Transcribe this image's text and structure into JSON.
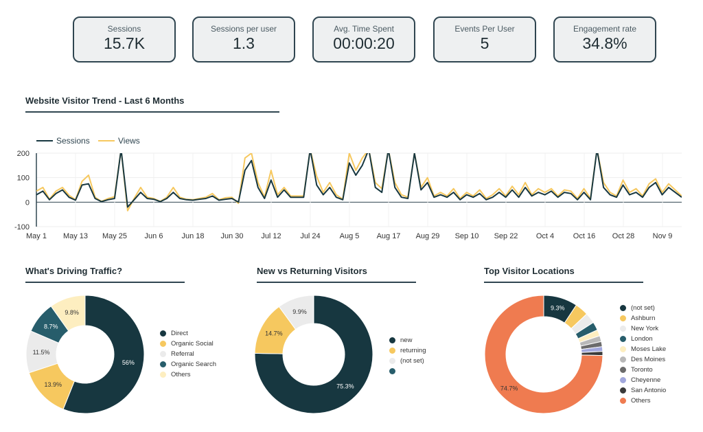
{
  "kpis": [
    {
      "label": "Sessions",
      "value": "15.7K"
    },
    {
      "label": "Sessions per user",
      "value": "1.3"
    },
    {
      "label": "Avg. Time Spent",
      "value": "00:00:20"
    },
    {
      "label": "Events Per User",
      "value": "5"
    },
    {
      "label": "Engagement rate",
      "value": "34.8%"
    }
  ],
  "trend": {
    "title": "Website Visitor Trend - Last 6 Months"
  },
  "chart_data": [
    {
      "type": "line",
      "title": "Website Visitor Trend - Last 6 Months",
      "ylim": [
        -100,
        200
      ],
      "yticks": [
        200,
        100,
        0,
        -100
      ],
      "grid": true,
      "legend": "top-left",
      "xticks": [
        "May 1",
        "May 13",
        "May 25",
        "Jun 6",
        "Jun 18",
        "Jun 30",
        "Jul 12",
        "Jul 24",
        "Aug 5",
        "Aug 17",
        "Aug 29",
        "Sep 10",
        "Sep 22",
        "Oct 4",
        "Oct 16",
        "Oct 28",
        "Nov 9"
      ],
      "series": [
        {
          "name": "Sessions",
          "color": "#173740",
          "values": [
            30,
            45,
            10,
            35,
            50,
            20,
            8,
            70,
            75,
            15,
            2,
            10,
            15,
            250,
            -20,
            10,
            40,
            15,
            12,
            2,
            15,
            40,
            15,
            10,
            8,
            12,
            15,
            25,
            8,
            12,
            15,
            0,
            130,
            170,
            60,
            15,
            90,
            20,
            50,
            20,
            20,
            20,
            250,
            70,
            30,
            60,
            20,
            10,
            160,
            110,
            150,
            250,
            60,
            40,
            250,
            60,
            20,
            15,
            200,
            50,
            80,
            20,
            30,
            20,
            40,
            10,
            30,
            20,
            35,
            10,
            20,
            40,
            20,
            50,
            20,
            60,
            25,
            40,
            30,
            45,
            20,
            40,
            35,
            10,
            40,
            10,
            250,
            60,
            30,
            20,
            70,
            30,
            40,
            20,
            60,
            80,
            30,
            60,
            40,
            20
          ]
        },
        {
          "name": "Views",
          "color": "#f6c85f",
          "values": [
            45,
            60,
            12,
            45,
            60,
            28,
            10,
            85,
            110,
            20,
            3,
            15,
            22,
            260,
            -35,
            15,
            60,
            20,
            15,
            3,
            20,
            60,
            20,
            12,
            10,
            15,
            20,
            35,
            10,
            18,
            20,
            -5,
            180,
            200,
            80,
            20,
            130,
            30,
            60,
            25,
            25,
            25,
            260,
            105,
            40,
            80,
            30,
            12,
            200,
            130,
            180,
            260,
            80,
            55,
            260,
            80,
            30,
            20,
            200,
            60,
            100,
            25,
            40,
            25,
            55,
            15,
            40,
            25,
            50,
            15,
            30,
            55,
            25,
            65,
            30,
            80,
            30,
            55,
            40,
            55,
            25,
            50,
            45,
            15,
            55,
            15,
            260,
            80,
            40,
            25,
            90,
            40,
            55,
            25,
            75,
            95,
            40,
            75,
            50,
            25
          ]
        }
      ]
    },
    {
      "type": "pie",
      "title": "What's Driving Traffic?",
      "labels": [
        "Direct",
        "Organic Social",
        "Referral",
        "Organic Search",
        "Others"
      ],
      "values": [
        56,
        13.9,
        11.5,
        8.7,
        9.8
      ],
      "colors": [
        "#173740",
        "#f6c85f",
        "#ebebeb",
        "#275d6b",
        "#fdeec0"
      ],
      "legend": "right"
    },
    {
      "type": "pie",
      "title": "New vs Returning Visitors",
      "labels": [
        "new",
        "returning",
        "(not set)",
        ""
      ],
      "values": [
        75.3,
        14.7,
        9.9,
        0.1
      ],
      "colors": [
        "#173740",
        "#f6c85f",
        "#ebebeb",
        "#275d6b"
      ],
      "legend": "right"
    },
    {
      "type": "pie",
      "title": "Top Visitor Locations",
      "labels": [
        "(not set)",
        "Ashburn",
        "New York",
        "London",
        "Moses Lake",
        "Des Moines",
        "Toronto",
        "Cheyenne",
        "San Antonio",
        "Others"
      ],
      "values": [
        9.3,
        3.7,
        2.9,
        2.3,
        1.7,
        1.6,
        1.4,
        1.3,
        1.1,
        74.7
      ],
      "colors": [
        "#173740",
        "#f6c85f",
        "#ebebeb",
        "#275d6b",
        "#fdeec0",
        "#b8b8b8",
        "#6b6b6b",
        "#a2a8dd",
        "#3a3a3a",
        "#ef7b50"
      ],
      "legend": "right"
    }
  ]
}
